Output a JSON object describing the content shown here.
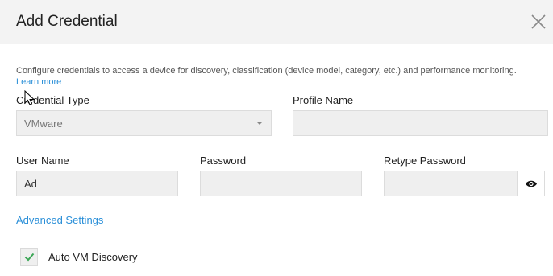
{
  "dialog": {
    "title": "Add Credential",
    "description": "Configure credentials to access a device for discovery, classification (device model, category, etc.) and performance monitoring.",
    "learn_more": "Learn more"
  },
  "form": {
    "credential_type": {
      "label": "Credential Type",
      "value": "VMware"
    },
    "profile_name": {
      "label": "Profile Name",
      "value": ""
    },
    "user_name": {
      "label": "User Name",
      "value": "Ad"
    },
    "password": {
      "label": "Password",
      "value": ""
    },
    "retype_password": {
      "label": "Retype Password",
      "value": ""
    }
  },
  "advanced_settings": "Advanced Settings",
  "auto_vm_discovery": {
    "label": "Auto VM Discovery",
    "checked": true
  },
  "icons": {
    "close": "close-icon",
    "dropdown": "chevron-down-icon",
    "reveal": "eye-icon",
    "check": "check-icon",
    "cursor": "mouse-pointer-icon"
  },
  "colors": {
    "link": "#2a8fd8",
    "check": "#3aa655",
    "header_bg": "#f3f3f3",
    "field_bg": "#efefef"
  }
}
